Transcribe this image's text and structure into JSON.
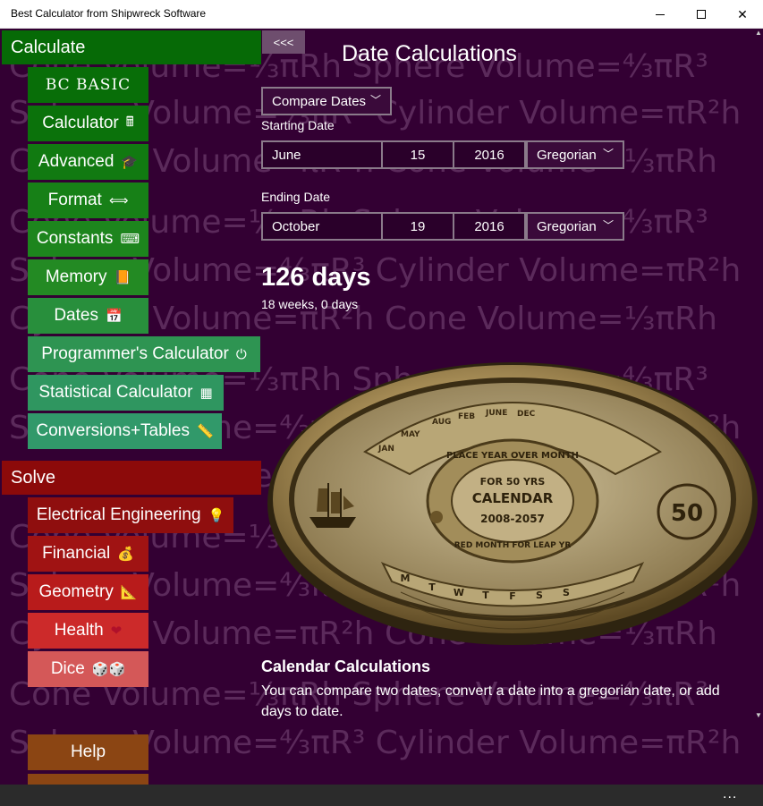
{
  "window": {
    "title": "Best Calculator from Shipwreck Software"
  },
  "watermark": {
    "rows": [
      "Cone Volume=⅓πRh  Sphere Volume=⁴⁄₃πR³",
      "Sphere Volume=⁴⁄₃πR³  Cylinder Volume=πR²h",
      "Cylinder Volume=πR²h  Cone Volume=⅓πRh",
      "Cone Volume=⅓πRh  Sphere Volume=⁴⁄₃πR³",
      "Sphere Volume=⁴⁄₃πR³  Cylinder Volume=πR²h",
      "Cylinder Volume=πR²h  Cone Volume=⅓πRh"
    ]
  },
  "nav": {
    "calculate_header": "Calculate",
    "solve_header": "Solve",
    "calculate_items": [
      {
        "label": "BC BASIC",
        "icon": ""
      },
      {
        "label": "Calculator",
        "icon": "🖩"
      },
      {
        "label": "Advanced",
        "icon": "🎓"
      },
      {
        "label": "Format",
        "icon": "⟺"
      },
      {
        "label": "Constants",
        "icon": "⌨"
      },
      {
        "label": "Memory",
        "icon": "📙"
      },
      {
        "label": "Dates",
        "icon": "📅"
      },
      {
        "label": "Programmer's Calculator",
        "icon": "⏻"
      },
      {
        "label": "Statistical Calculator",
        "icon": "▦"
      },
      {
        "label": "Conversions+Tables",
        "icon": "📏"
      }
    ],
    "solve_items": [
      {
        "label": "Electrical Engineering",
        "icon": "💡"
      },
      {
        "label": "Financial",
        "icon": "💰"
      },
      {
        "label": "Geometry",
        "icon": "📐"
      },
      {
        "label": "Health",
        "icon": "❤"
      },
      {
        "label": "Dice",
        "icon": "🎲🎲"
      }
    ],
    "help_label": "Help",
    "collapse_label": "<<<"
  },
  "colors": {
    "calculate_green": "#066a06",
    "solve_red": "#8c0a0a",
    "help_brown": "#8b4513",
    "background": "#330033"
  },
  "main": {
    "title": "Date Calculations",
    "mode_select": "Compare Dates",
    "starting_label": "Starting Date",
    "start": {
      "month": "June",
      "day": "15",
      "year": "2016",
      "calendar": "Gregorian"
    },
    "ending_label": "Ending Date",
    "end": {
      "month": "October",
      "day": "19",
      "year": "2016",
      "calendar": "Gregorian"
    },
    "result": "126 days",
    "result_detail": "18 weeks, 0 days",
    "section_heading": "Calendar Calculations",
    "section_text": "You can compare two dates, convert a date into a gregorian date, or add days to date."
  },
  "calendar_image": {
    "ring_text": "PLACE YEAR OVER MONTH",
    "center_title": "CALENDAR",
    "center_sub": "FOR 50 YRS",
    "center_range": "2008-2057",
    "bottom_ring": "RED MONTH FOR LEAP YR",
    "badge": "50",
    "months": [
      "JAN",
      "MAY",
      "AUG",
      "FEB",
      "JUNE",
      "DEC"
    ],
    "days": [
      "M",
      "T",
      "W",
      "T",
      "F",
      "S",
      "S"
    ]
  },
  "bottombar": {
    "more_label": "..."
  }
}
